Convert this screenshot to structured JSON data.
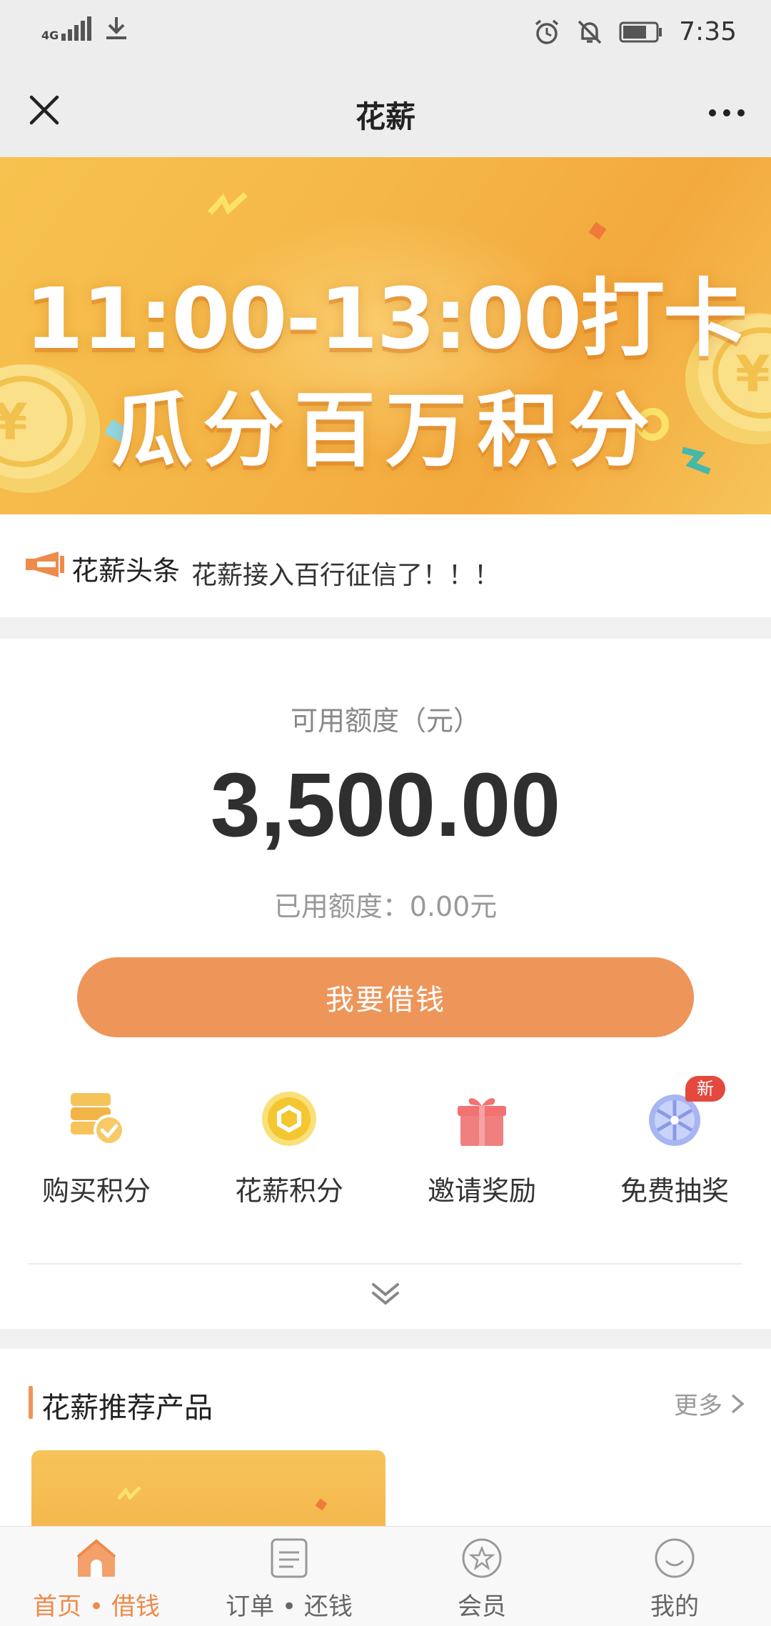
{
  "status_bar": {
    "network": "4G",
    "time": "7:35"
  },
  "nav": {
    "title": "花薪"
  },
  "banner": {
    "line1": "11:00-13:00打卡",
    "line2": "瓜分百万积分"
  },
  "headline": {
    "tag": "花薪头条",
    "text": "花薪接入百行征信了！！！"
  },
  "credit": {
    "label": "可用额度（元）",
    "amount": "3,500.00",
    "used": "已用额度：0.00元",
    "borrow_button": "我要借钱"
  },
  "quick_actions": [
    {
      "label": "购买积分",
      "icon": "coins-check-icon"
    },
    {
      "label": "花薪积分",
      "icon": "points-coin-icon"
    },
    {
      "label": "邀请奖励",
      "icon": "gift-icon"
    },
    {
      "label": "免费抽奖",
      "icon": "lottery-wheel-icon",
      "badge": "新"
    }
  ],
  "recommend": {
    "title": "花薪推荐产品",
    "more": "更多"
  },
  "tabs": [
    {
      "label": "首页 • 借钱",
      "icon": "home-icon",
      "active": true
    },
    {
      "label": "订单 • 还钱",
      "icon": "order-icon",
      "active": false
    },
    {
      "label": "会员",
      "icon": "member-star-icon",
      "active": false
    },
    {
      "label": "我的",
      "icon": "profile-smile-icon",
      "active": false
    }
  ],
  "colors": {
    "accent": "#ee955a",
    "active_tab": "#ee8a4a",
    "banner": "#f5b748"
  }
}
